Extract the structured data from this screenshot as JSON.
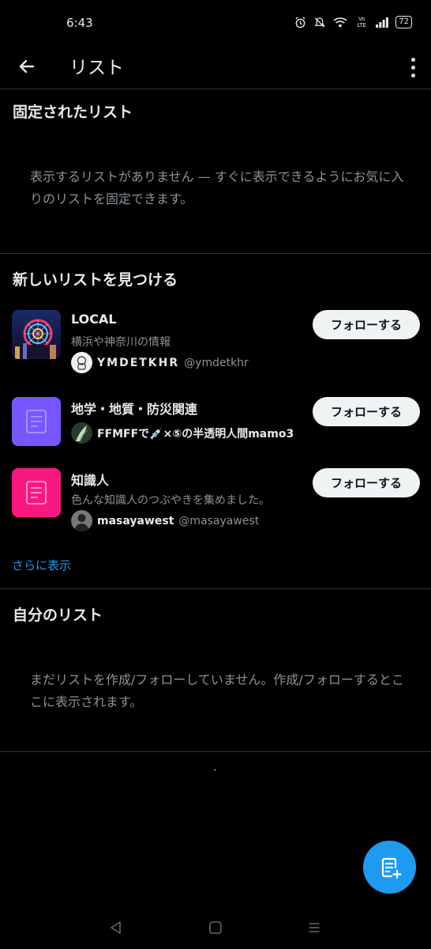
{
  "status_bar": {
    "time": "6:43",
    "volte": "Vo LTE",
    "battery": "72"
  },
  "header": {
    "title": "リスト"
  },
  "pinned": {
    "title": "固定されたリスト",
    "empty_text": "表示するリストがありません — すぐに表示できるようにお気に入りのリストを固定できます。"
  },
  "discover": {
    "title": "新しいリストを見つける",
    "items": [
      {
        "name": "LOCAL",
        "description": "横浜や神奈川の情報",
        "owner_name": "YMDETKHR",
        "owner_handle": "@ymdetkhr",
        "follow_label": "フォローする",
        "thumb": "photo"
      },
      {
        "name": "地学・地質・防災関連",
        "description": "",
        "owner_name": "FFMFFで💉×⑤の半透明人間mamo3",
        "owner_handle": "",
        "follow_label": "フォローする",
        "thumb": "list-icon",
        "thumb_color": "#7856ff"
      },
      {
        "name": "知識人",
        "description": "色んな知識人のつぶやきを集めました。",
        "owner_name": "masayawest",
        "owner_handle": "@masayawest",
        "follow_label": "フォローする",
        "thumb": "list-icon",
        "thumb_color": "#f91880"
      }
    ],
    "show_more": "さらに表示"
  },
  "my_lists": {
    "title": "自分のリスト",
    "empty_text": "まだリストを作成/フォローしていません。作成/フォローするとここに表示されます。"
  },
  "fab": {
    "icon": "new-list-icon"
  },
  "colors": {
    "accent": "#1d9bf0",
    "background": "#000000",
    "divider": "#2f3336",
    "secondary_text": "#8b9399"
  }
}
